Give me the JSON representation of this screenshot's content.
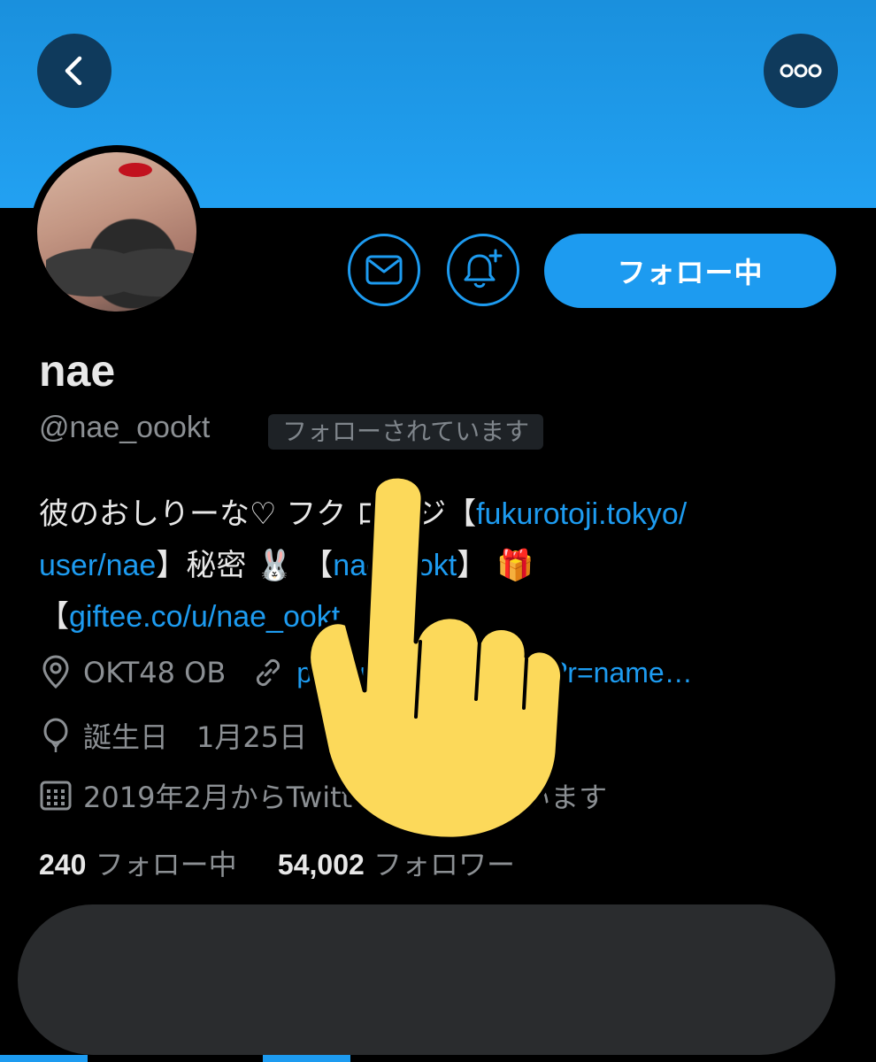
{
  "header": {
    "back_icon": "chevron-left-icon",
    "more_icon": "more-horizontal-icon",
    "banner_color": "#1d9bf0"
  },
  "actions": {
    "dm_icon": "mail-icon",
    "notify_icon": "bell-plus-icon",
    "follow_label": "フォロー中"
  },
  "profile": {
    "name": "nae",
    "handle": "@nae_oookt",
    "follows_you": "フォローされています"
  },
  "bio": {
    "line1_text": "彼のおしりーな♡ フク ロトジ【",
    "line1_link": "fukurotoji.tokyo/",
    "line2_link": "user/nae",
    "line2_text": "】秘密",
    "line2_emoji": "🐰",
    "line2_bracket": "【",
    "line2_link2": "nae_ookt",
    "line2_text2": "】",
    "line2_gift": "🎁",
    "line3_bracket": "【",
    "line3_link": "giftee.co/u/nae_ookt"
  },
  "meta": {
    "location": "OKT48 OB",
    "website": "peing.net/ja/nae_okt?r=name…",
    "birthday": "誕生日　1月25日",
    "joined": "2019年2月からTwitterを利用しています"
  },
  "stats": {
    "following_count": "240",
    "following_label": "フォロー中",
    "followers_count": "54,002",
    "followers_label": "フォロワー"
  },
  "colors": {
    "accent": "#1d9bf0",
    "text_primary": "#e7e7e7",
    "text_secondary": "#8b8f93",
    "hand": "#fcd95a"
  }
}
